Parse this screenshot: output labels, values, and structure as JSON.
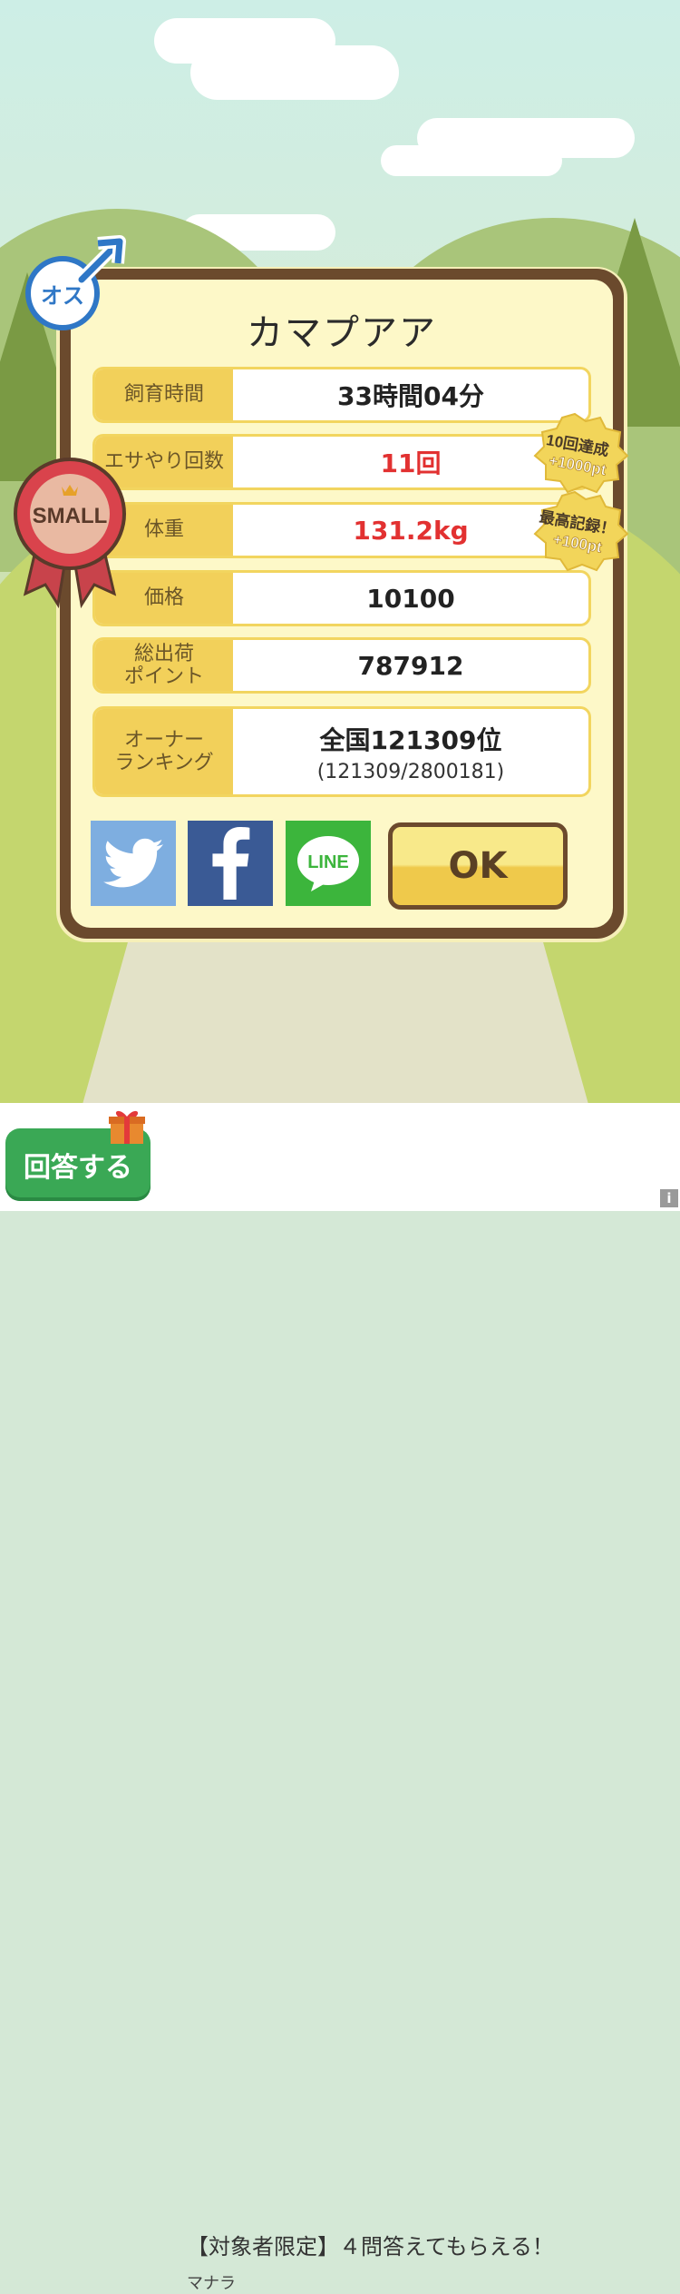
{
  "dialog": {
    "pig_name": "カマプアア",
    "rows": [
      {
        "label": "飼育時間",
        "value": "33時間04分",
        "highlight": false
      },
      {
        "label": "エサやり回数",
        "value": "11回",
        "highlight": true
      },
      {
        "label": "体重",
        "value": "131.2kg",
        "highlight": true
      },
      {
        "label": "価格",
        "value": "10100",
        "highlight": false
      },
      {
        "label": "総出荷\nポイント",
        "value": "787912",
        "highlight": false
      },
      {
        "label": "オーナー\nランキング",
        "value": "全国121309位",
        "sub": "(121309/2800181)",
        "highlight": false
      }
    ],
    "ok_label": "OK",
    "gender_label": "オス",
    "size_badge": "SMALL",
    "badges": [
      {
        "line1": "10回達成",
        "line2": "+1000pt"
      },
      {
        "line1": "最高記録！",
        "line2": "+100pt"
      }
    ],
    "social": [
      "twitter-icon",
      "facebook-icon",
      "line-icon"
    ],
    "line_text": "LINE"
  },
  "ad": {
    "button_label": "回答する",
    "title": "【対象者限定】４問答えてもらえる！",
    "sponsor": "マナラ",
    "info": "i"
  },
  "colors": {
    "frame": "#6b4a2d",
    "panel": "#fdf8c8",
    "label_bg": "#f2d05a",
    "highlight_text": "#e23131",
    "twitter": "#7eaee0",
    "facebook": "#3a5a95",
    "line": "#3cb53c",
    "ad_button": "#3aa855"
  }
}
